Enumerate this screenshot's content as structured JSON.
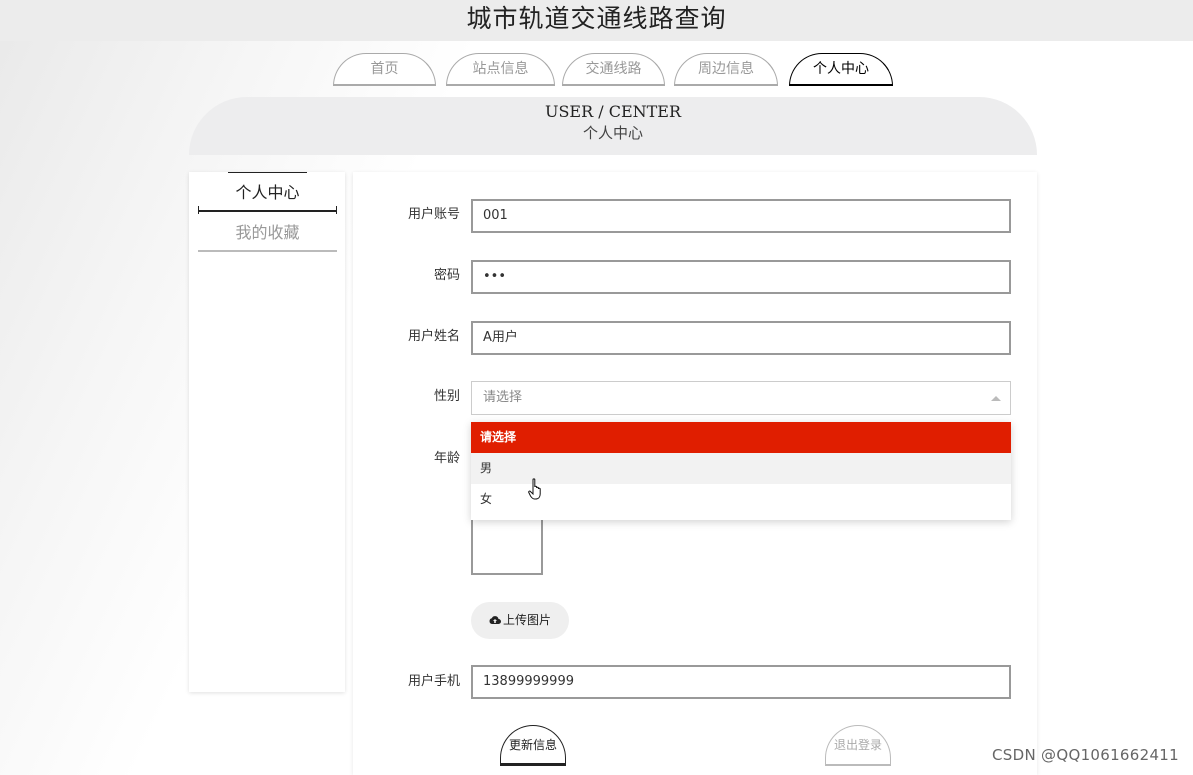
{
  "site": {
    "title": "城市轨道交通线路查询"
  },
  "nav": {
    "tabs": [
      {
        "label": "首页"
      },
      {
        "label": "站点信息"
      },
      {
        "label": "交通线路"
      },
      {
        "label": "周边信息"
      },
      {
        "label": "个人中心"
      }
    ],
    "active_index": 4
  },
  "banner": {
    "en": "USER / CENTER",
    "cn": "个人中心"
  },
  "sidebar": {
    "items": [
      {
        "label": "个人中心"
      },
      {
        "label": "我的收藏"
      }
    ],
    "active_index": 0
  },
  "form": {
    "account": {
      "label": "用户账号",
      "value": "001"
    },
    "password": {
      "label": "密码",
      "value": "•••"
    },
    "name": {
      "label": "用户姓名",
      "value": "A用户"
    },
    "gender": {
      "label": "性别",
      "placeholder": "请选择",
      "options": [
        "请选择",
        "男",
        "女"
      ],
      "highlighted_option": "请选择",
      "hovered_option": "男"
    },
    "age": {
      "label": "年龄"
    },
    "upload_label": "上传图片",
    "phone": {
      "label": "用户手机",
      "value": "13899999999"
    }
  },
  "actions": {
    "update": "更新信息",
    "logout": "退出登录"
  },
  "watermark": "CSDN @QQ1061662411",
  "colors": {
    "accent": "#e01e00",
    "banner_bg": "#ededee",
    "topbar_bg": "#ececec"
  },
  "icons": {
    "upload": "cloud-upload-icon",
    "caret": "caret-up-icon",
    "cursor": "hand-pointer-icon"
  }
}
